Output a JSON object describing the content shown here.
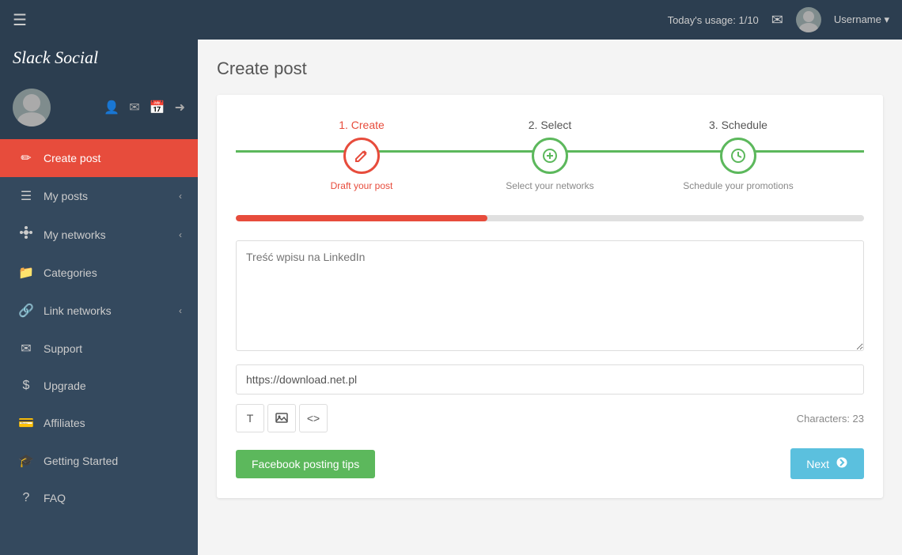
{
  "topbar": {
    "hamburger": "☰",
    "usage_label": "Today's usage: 1/10",
    "mail_icon": "✉",
    "user_name": "Username ▾",
    "caret": "▾"
  },
  "logo": {
    "text": "Slack Social",
    "icon": "🐾"
  },
  "sidebar": {
    "profile_icons": {
      "user": "👤",
      "mail": "✉",
      "calendar": "📅",
      "exit": "➜"
    },
    "items": [
      {
        "id": "create-post",
        "label": "Create post",
        "icon": "✏",
        "active": true,
        "has_chevron": false
      },
      {
        "id": "my-posts",
        "label": "My posts",
        "icon": "☰",
        "active": false,
        "has_chevron": true
      },
      {
        "id": "my-networks",
        "label": "My networks",
        "icon": "📡",
        "active": false,
        "has_chevron": true
      },
      {
        "id": "categories",
        "label": "Categories",
        "icon": "📁",
        "active": false,
        "has_chevron": false
      },
      {
        "id": "link-networks",
        "label": "Link networks",
        "icon": "🔗",
        "active": false,
        "has_chevron": true
      },
      {
        "id": "support",
        "label": "Support",
        "icon": "✉",
        "active": false,
        "has_chevron": false
      },
      {
        "id": "upgrade",
        "label": "Upgrade",
        "icon": "$",
        "active": false,
        "has_chevron": false
      },
      {
        "id": "affiliates",
        "label": "Affiliates",
        "icon": "💳",
        "active": false,
        "has_chevron": false
      },
      {
        "id": "getting-started",
        "label": "Getting Started",
        "icon": "🎓",
        "active": false,
        "has_chevron": false
      },
      {
        "id": "faq",
        "label": "FAQ",
        "icon": "?",
        "active": false,
        "has_chevron": false
      }
    ]
  },
  "page": {
    "title": "Create post"
  },
  "stepper": {
    "steps": [
      {
        "number": "1.",
        "label": "Create",
        "sublabel": "Draft your post",
        "icon": "✏",
        "state": "active"
      },
      {
        "number": "2.",
        "label": "Select",
        "sublabel": "Select your networks",
        "icon": "☰",
        "state": "green"
      },
      {
        "number": "3.",
        "label": "Schedule",
        "sublabel": "Schedule your promotions",
        "icon": "🕐",
        "state": "green"
      }
    ]
  },
  "progress": {
    "percentage": 40
  },
  "form": {
    "textarea_placeholder": "Treść wpisu na LinkedIn",
    "url_value": "https://download.net.pl",
    "characters_label": "Characters: 23",
    "toolbar_text_icon": "T",
    "toolbar_photo_icon": "📷",
    "toolbar_code_icon": "<>",
    "facebook_tips_label": "Facebook posting tips",
    "next_label": "Next",
    "next_icon": "→"
  }
}
